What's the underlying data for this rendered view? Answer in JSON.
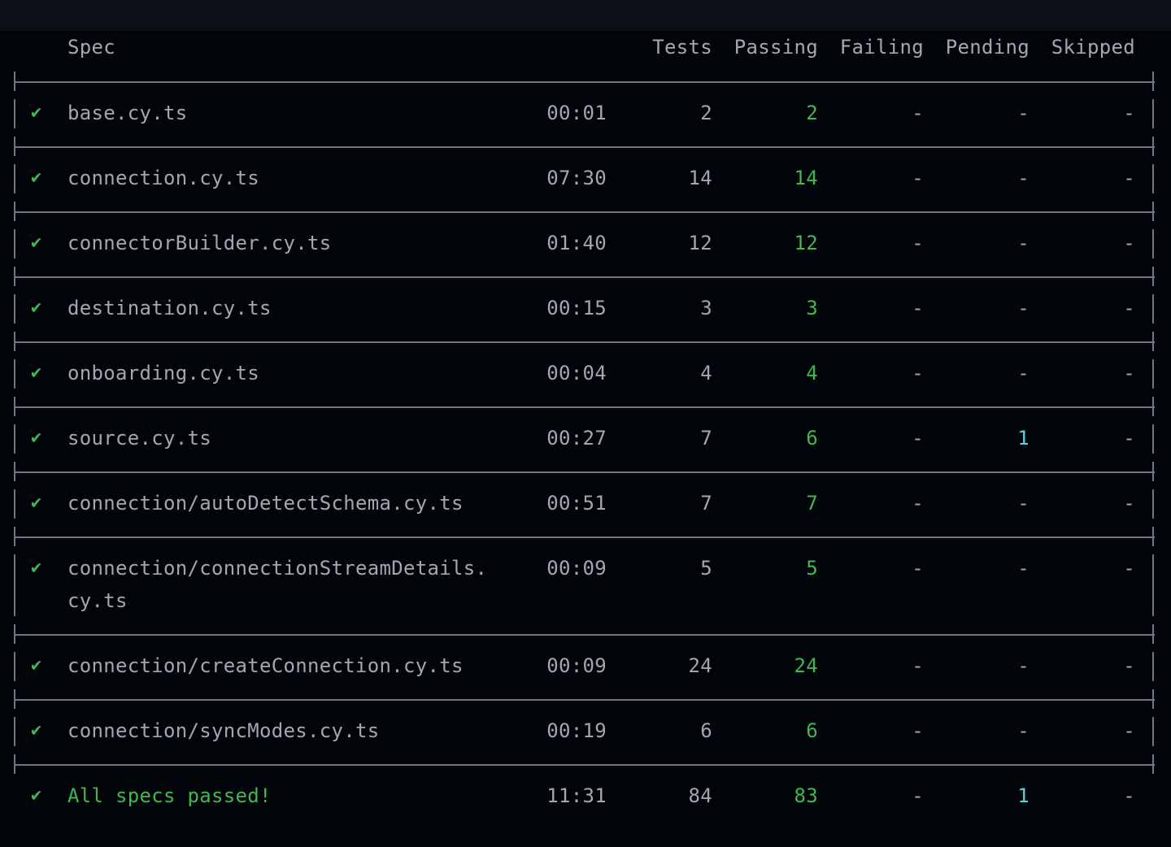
{
  "header": {
    "spec": "Spec",
    "tests": "Tests",
    "passing": "Passing",
    "failing": "Failing",
    "pending": "Pending",
    "skipped": "Skipped"
  },
  "rows": [
    {
      "status_icon": "checkmark-icon",
      "spec": "base.cy.ts",
      "time": "00:01",
      "tests": "2",
      "passing": "2",
      "failing": "-",
      "pending": "-",
      "skipped": "-"
    },
    {
      "status_icon": "checkmark-icon",
      "spec": "connection.cy.ts",
      "time": "07:30",
      "tests": "14",
      "passing": "14",
      "failing": "-",
      "pending": "-",
      "skipped": "-"
    },
    {
      "status_icon": "checkmark-icon",
      "spec": "connectorBuilder.cy.ts",
      "time": "01:40",
      "tests": "12",
      "passing": "12",
      "failing": "-",
      "pending": "-",
      "skipped": "-"
    },
    {
      "status_icon": "checkmark-icon",
      "spec": "destination.cy.ts",
      "time": "00:15",
      "tests": "3",
      "passing": "3",
      "failing": "-",
      "pending": "-",
      "skipped": "-"
    },
    {
      "status_icon": "checkmark-icon",
      "spec": "onboarding.cy.ts",
      "time": "00:04",
      "tests": "4",
      "passing": "4",
      "failing": "-",
      "pending": "-",
      "skipped": "-"
    },
    {
      "status_icon": "checkmark-icon",
      "spec": "source.cy.ts",
      "time": "00:27",
      "tests": "7",
      "passing": "6",
      "failing": "-",
      "pending": "1",
      "skipped": "-"
    },
    {
      "status_icon": "checkmark-icon",
      "spec": "connection/autoDetectSchema.cy.ts",
      "time": "00:51",
      "tests": "7",
      "passing": "7",
      "failing": "-",
      "pending": "-",
      "skipped": "-"
    },
    {
      "status_icon": "checkmark-icon",
      "spec": "connection/connectionStreamDetails.",
      "spec_cont": "cy.ts",
      "time": "00:09",
      "tests": "5",
      "passing": "5",
      "failing": "-",
      "pending": "-",
      "skipped": "-"
    },
    {
      "status_icon": "checkmark-icon",
      "spec": "connection/createConnection.cy.ts",
      "time": "00:09",
      "tests": "24",
      "passing": "24",
      "failing": "-",
      "pending": "-",
      "skipped": "-"
    },
    {
      "status_icon": "checkmark-icon",
      "spec": "connection/syncModes.cy.ts",
      "time": "00:19",
      "tests": "6",
      "passing": "6",
      "failing": "-",
      "pending": "-",
      "skipped": "-"
    }
  ],
  "summary": {
    "status_icon": "checkmark-icon",
    "label": "All specs passed!",
    "time": "11:31",
    "tests": "84",
    "passing": "83",
    "failing": "-",
    "pending": "1",
    "skipped": "-"
  },
  "colors": {
    "background": "#010409",
    "titlebar": "#0d1117",
    "text": "#a1a8b1",
    "green": "#3fb950",
    "cyan": "#56d4dd",
    "border": "#6e7681"
  }
}
